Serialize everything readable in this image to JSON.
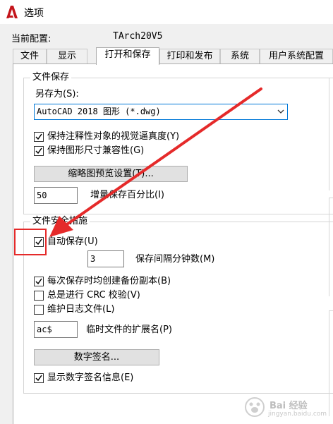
{
  "window": {
    "title": "选项",
    "app_icon": "autocad-a-icon",
    "brand_color": "#c4161c"
  },
  "profile": {
    "label": "当前配置:",
    "value": "TArch20V5"
  },
  "tabs": [
    {
      "label": "文件",
      "active": false
    },
    {
      "label": "显示",
      "active": false
    },
    {
      "label": "打开和保存",
      "active": true
    },
    {
      "label": "打印和发布",
      "active": false
    },
    {
      "label": "系统",
      "active": false
    },
    {
      "label": "用户系统配置",
      "active": false
    }
  ],
  "file_save": {
    "title": "文件保存",
    "save_as_label": "另存为(S):",
    "save_as_value": "AutoCAD 2018 图形 (*.dwg)",
    "checkbox_annotative": {
      "label": "保持注释性对象的视觉逼真度(Y)",
      "checked": true
    },
    "checkbox_drawing_size": {
      "label": "保持图形尺寸兼容性(G)",
      "checked": true
    },
    "thumbnail_button": "缩略图预览设置(T)...",
    "incremental_value": "50",
    "incremental_label": "增量保存百分比(I)"
  },
  "file_safety": {
    "title": "文件安全措施",
    "autosave": {
      "label": "自动保存(U)",
      "checked": true
    },
    "interval_value": "3",
    "interval_label": "保存间隔分钟数(M)",
    "backup": {
      "label": "每次保存时均创建备份副本(B)",
      "checked": true
    },
    "crc": {
      "label": "总是进行 CRC 校验(V)",
      "checked": false
    },
    "log": {
      "label": "维护日志文件(L)",
      "checked": false
    },
    "temp_ext_value": "ac$",
    "temp_ext_label": "临时文件的扩展名(P)",
    "digital_sign_button": "数字签名...",
    "show_sign": {
      "label": "显示数字签名信息(E)",
      "checked": true
    }
  },
  "annotation": {
    "color": "#e52a2a"
  },
  "watermark": {
    "text": "Bai 经验",
    "sub": "jingyan.baidu.com"
  }
}
